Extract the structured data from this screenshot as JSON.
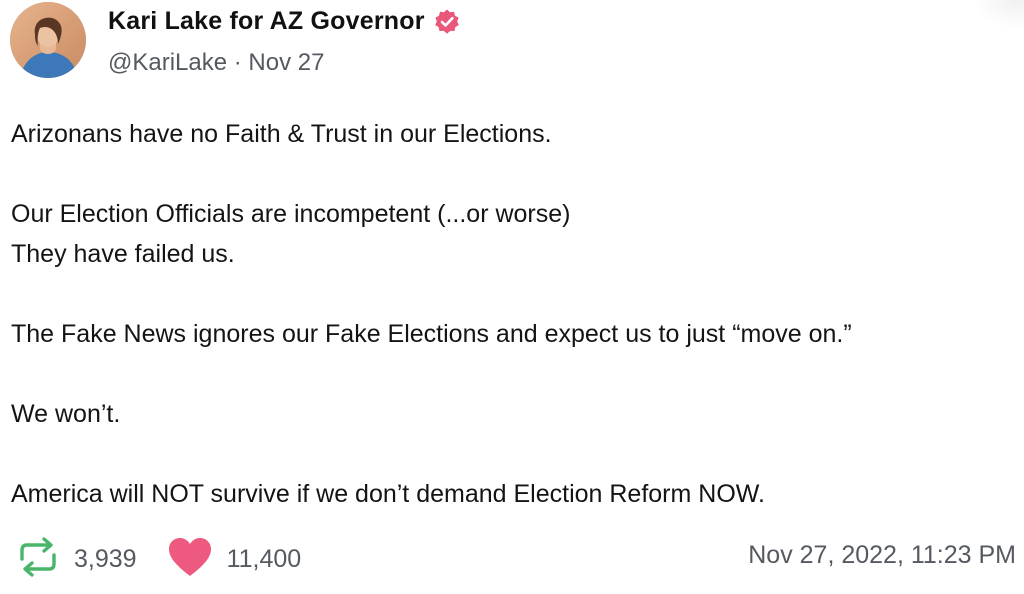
{
  "post": {
    "author_name": "Kari Lake for AZ Governor",
    "handle_and_date": "@KariLake · Nov 27",
    "verified_icon": "verified-badge-icon",
    "lines": [
      "Arizonans have no Faith & Trust in our Elections.",
      "",
      "Our Election Officials are incompetent (...or worse)",
      "They have failed us.",
      "",
      "The Fake News ignores our Fake Elections and expect us to just “move on.”",
      "",
      "We won’t.",
      "",
      "America will NOT survive if we don’t demand Election Reform NOW."
    ]
  },
  "actions": {
    "repost_icon": "repost-icon",
    "repost_count": "3,939",
    "like_icon": "heart-icon",
    "like_count": "11,400"
  },
  "timestamp": "Nov 27, 2022, 11:23 PM",
  "colors": {
    "badge": "#e9577a",
    "heart": "#ee5a7f",
    "repost": "#48b56a",
    "muted_text": "#555a61"
  }
}
